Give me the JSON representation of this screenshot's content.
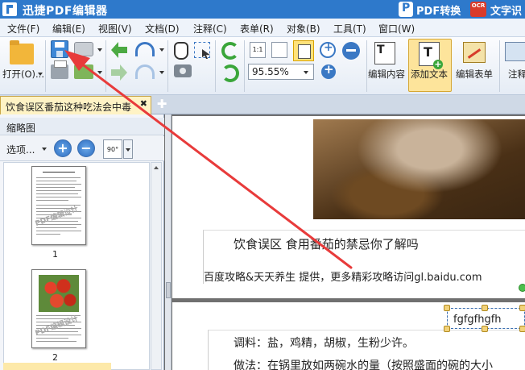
{
  "app": {
    "title": "迅捷PDF编辑器",
    "pdf_convert": "PDF转换",
    "ocr_badge": "OCR",
    "ocr_label": "文字识"
  },
  "menu": [
    "文件(F)",
    "编辑(E)",
    "视图(V)",
    "文档(D)",
    "注释(C)",
    "表单(R)",
    "对象(B)",
    "工具(T)",
    "窗口(W)"
  ],
  "toolbar": {
    "open_label": "打开(O)...",
    "page_size_label": "1:1",
    "zoom_value": "95.55%",
    "edit_content_label": "编辑内容",
    "add_text_label": "添加文本",
    "edit_form_label": "编辑表单",
    "annotation_label": "注释"
  },
  "tab": {
    "title": "饮食误区番茄这种吃法会中毒",
    "close": "✖",
    "new_tab": "✚"
  },
  "thumbnail_panel": {
    "title": "缩略图",
    "options_label": "选项...",
    "rotate_label": "90°",
    "zoom_in": "+",
    "zoom_out": "−",
    "pages": [
      {
        "number": "1",
        "watermark": "PDF编辑设计"
      },
      {
        "number": "2",
        "watermark": "PDF编辑设计"
      }
    ]
  },
  "document": {
    "heading": "饮食误区 食用番茄的禁忌你了解吗",
    "credit": "百度攻略&天天养生 提供，更多精彩攻略访问gl.baidu.com",
    "seasoning": "调料：盐，鸡精，胡椒，生粉少许。",
    "method": "做法：在锅里放如两碗水的量（按照盛面的碗的大小",
    "inserted_text": "fgfgfhgfh"
  },
  "colors": {
    "titlebar": "#2e79cb",
    "active_tab": "#fff3c5",
    "pointer_arrow": "#e83b3b"
  }
}
